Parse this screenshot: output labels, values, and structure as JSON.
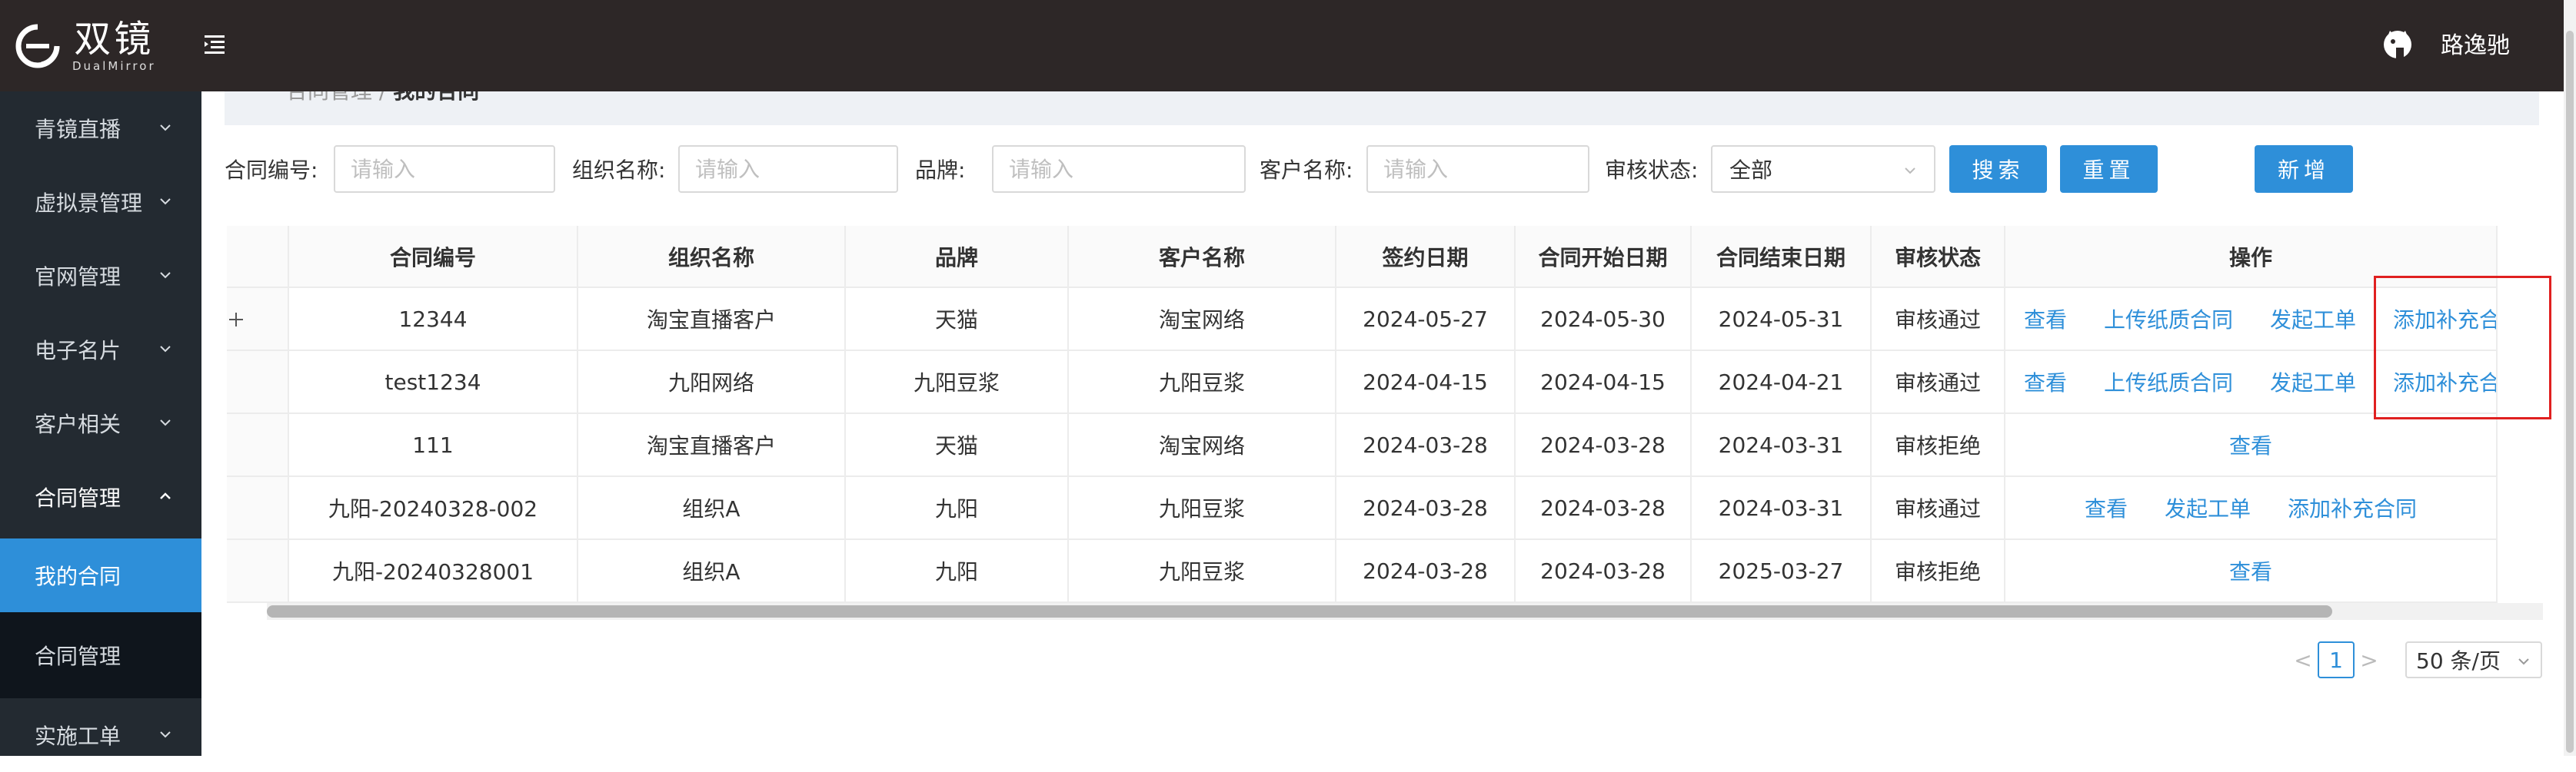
{
  "header": {
    "logo_cn": "双镜",
    "logo_en": "DualMirror",
    "user_name": "路逸驰"
  },
  "sidebar": {
    "items": [
      {
        "label": "青镜直播"
      },
      {
        "label": "虚拟景管理"
      },
      {
        "label": "官网管理"
      },
      {
        "label": "电子名片"
      },
      {
        "label": "客户相关"
      },
      {
        "label": "合同管理"
      },
      {
        "label": "实施工单"
      }
    ],
    "subitems": [
      {
        "label": "我的合同",
        "active": true
      },
      {
        "label": "合同管理",
        "active": false
      }
    ]
  },
  "breadcrumb": {
    "parent": "合同管理 / ",
    "current": "我的合同"
  },
  "filters": {
    "contract_no_label": "合同编号:",
    "org_label": "组织名称:",
    "brand_label": "品牌:",
    "customer_label": "客户名称:",
    "status_label": "审核状态:",
    "placeholder": "请输入",
    "status_value": "全部",
    "search_btn": "搜索",
    "reset_btn": "重置",
    "add_btn": "新增"
  },
  "table": {
    "headers": [
      "合同编号",
      "组织名称",
      "品牌",
      "客户名称",
      "签约日期",
      "合同开始日期",
      "合同结束日期",
      "审核状态",
      "操作"
    ],
    "rows": [
      {
        "no": "12344",
        "org": "淘宝直播客户",
        "brand": "天猫",
        "customer": "淘宝网络",
        "sign": "2024-05-27",
        "start": "2024-05-30",
        "end": "2024-05-31",
        "status": "审核通过",
        "ops": [
          "查看",
          "上传纸质合同",
          "发起工单",
          "添加补充合同"
        ],
        "expandable": true
      },
      {
        "no": "test1234",
        "org": "九阳网络",
        "brand": "九阳豆浆",
        "customer": "九阳豆浆",
        "sign": "2024-04-15",
        "start": "2024-04-15",
        "end": "2024-04-21",
        "status": "审核通过",
        "ops": [
          "查看",
          "上传纸质合同",
          "发起工单",
          "添加补充合同"
        ],
        "expandable": false
      },
      {
        "no": "111",
        "org": "淘宝直播客户",
        "brand": "天猫",
        "customer": "淘宝网络",
        "sign": "2024-03-28",
        "start": "2024-03-28",
        "end": "2024-03-31",
        "status": "审核拒绝",
        "ops": [
          "查看"
        ],
        "expandable": false
      },
      {
        "no": "九阳-20240328-002",
        "org": "组织A",
        "brand": "九阳",
        "customer": "九阳豆浆",
        "sign": "2024-03-28",
        "start": "2024-03-28",
        "end": "2024-03-31",
        "status": "审核通过",
        "ops": [
          "查看",
          "发起工单",
          "添加补充合同"
        ],
        "expandable": false
      },
      {
        "no": "九阳-20240328001",
        "org": "组织A",
        "brand": "九阳",
        "customer": "九阳豆浆",
        "sign": "2024-03-28",
        "start": "2024-03-28",
        "end": "2025-03-27",
        "status": "审核拒绝",
        "ops": [
          "查看"
        ],
        "expandable": false
      }
    ]
  },
  "pagination": {
    "prev": "<",
    "page": "1",
    "next": ">",
    "page_size": "50 条/页"
  },
  "colors": {
    "accent": "#2e8fd9",
    "topbar": "#2d2727",
    "sidebar": "#232a31",
    "highlight": "#e02020"
  }
}
